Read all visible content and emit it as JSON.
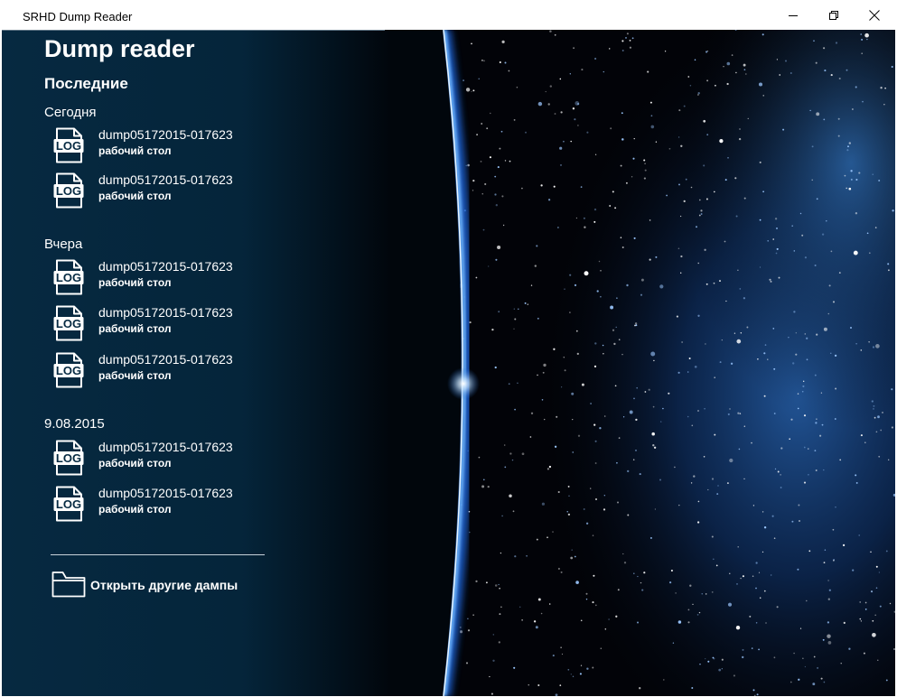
{
  "window": {
    "title": "SRHD Dump Reader",
    "controls": {
      "minimize": "minimize-icon",
      "maximize": "restore-icon",
      "close": "close-icon"
    }
  },
  "app": {
    "title": "Dump reader",
    "recent_label": "Последние"
  },
  "groups": [
    {
      "label": "Сегодня",
      "items": [
        {
          "name": "dump05172015-017623",
          "location": "рабочий стол",
          "icon": "log-file-icon"
        },
        {
          "name": "dump05172015-017623",
          "location": "рабочий стол",
          "icon": "log-file-icon"
        }
      ]
    },
    {
      "label": "Вчера",
      "items": [
        {
          "name": "dump05172015-017623",
          "location": "рабочий стол",
          "icon": "log-file-icon"
        },
        {
          "name": "dump05172015-017623",
          "location": "рабочий стол",
          "icon": "log-file-icon"
        },
        {
          "name": "dump05172015-017623",
          "location": "рабочий стол",
          "icon": "log-file-icon"
        }
      ]
    },
    {
      "label": "9.08.2015",
      "items": [
        {
          "name": "dump05172015-017623",
          "location": "рабочий стол",
          "icon": "log-file-icon"
        },
        {
          "name": "dump05172015-017623",
          "location": "рабочий стол",
          "icon": "log-file-icon"
        }
      ]
    }
  ],
  "actions": {
    "open_other": "Открыть другие дампы",
    "open_other_icon": "folder-icon"
  },
  "colors": {
    "panel": "#062a42",
    "space_glow": "#3a8fe8",
    "text": "#ffffff"
  }
}
